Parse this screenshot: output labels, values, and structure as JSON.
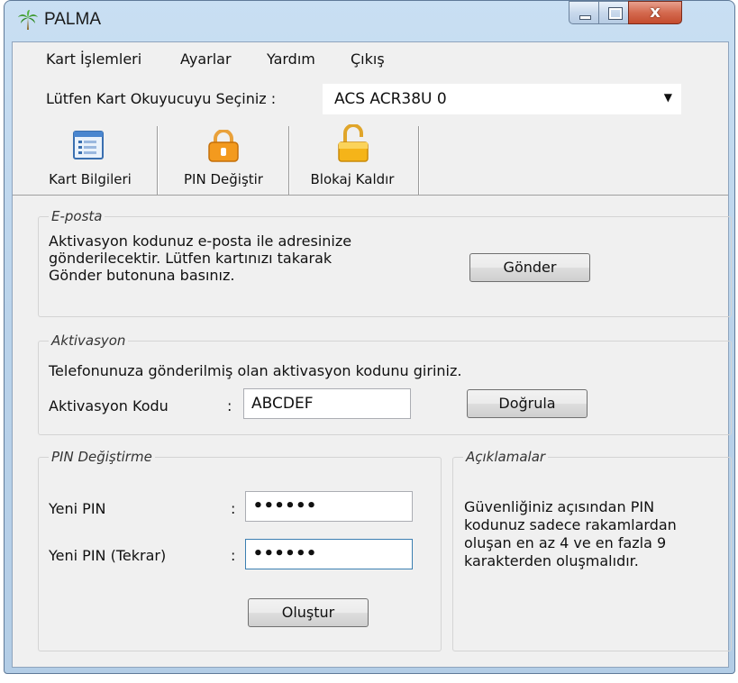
{
  "window": {
    "title": "PALMA",
    "close_glyph": "x",
    "icon": "palm-tree-icon"
  },
  "menu": [
    "Kart İşlemleri",
    "Ayarlar",
    "Yardım",
    "Çıkış"
  ],
  "reader": {
    "label": "Lütfen Kart Okuyucuyu Seçiniz :",
    "value": "ACS ACR38U 0"
  },
  "toolbar": [
    {
      "label": "Kart Bilgileri",
      "icon": "card-info-icon"
    },
    {
      "label": "PIN Değiştir",
      "icon": "lock-icon"
    },
    {
      "label": "Blokaj Kaldır",
      "icon": "unlock-icon"
    }
  ],
  "email": {
    "title": "E-posta",
    "text": [
      "Aktivasyon kodunuz e-posta ile adresinize",
      "gönderilecektir. Lütfen kartınızı takarak",
      "Gönder butonuna basınız."
    ],
    "button": "Gönder"
  },
  "activation": {
    "title": "Aktivasyon",
    "instruction": "Telefonunuza gönderilmiş olan aktivasyon kodunu giriniz.",
    "label": "Aktivasyon Kodu",
    "colon": ":",
    "value": "ABCDEF",
    "button": "Doğrula"
  },
  "pin_change": {
    "title": "PIN Değiştirme",
    "new_pin_label": "Yeni PIN",
    "repeat_pin_label": "Yeni PIN (Tekrar)",
    "colon": ":",
    "new_pin_value": "••••••",
    "repeat_pin_value": "••••••",
    "button": "Oluştur"
  },
  "notes": {
    "title": "Açıklamalar",
    "text": [
      "Güvenliğiniz açısından PIN",
      "kodunuz sadece rakamlardan",
      "oluşan en az 4 ve en fazla 9",
      "karakterden oluşmalıdır."
    ]
  },
  "colors": {
    "accent": "#f0a020",
    "window_frame": "#b9d2ea",
    "close": "#c44b2e"
  }
}
